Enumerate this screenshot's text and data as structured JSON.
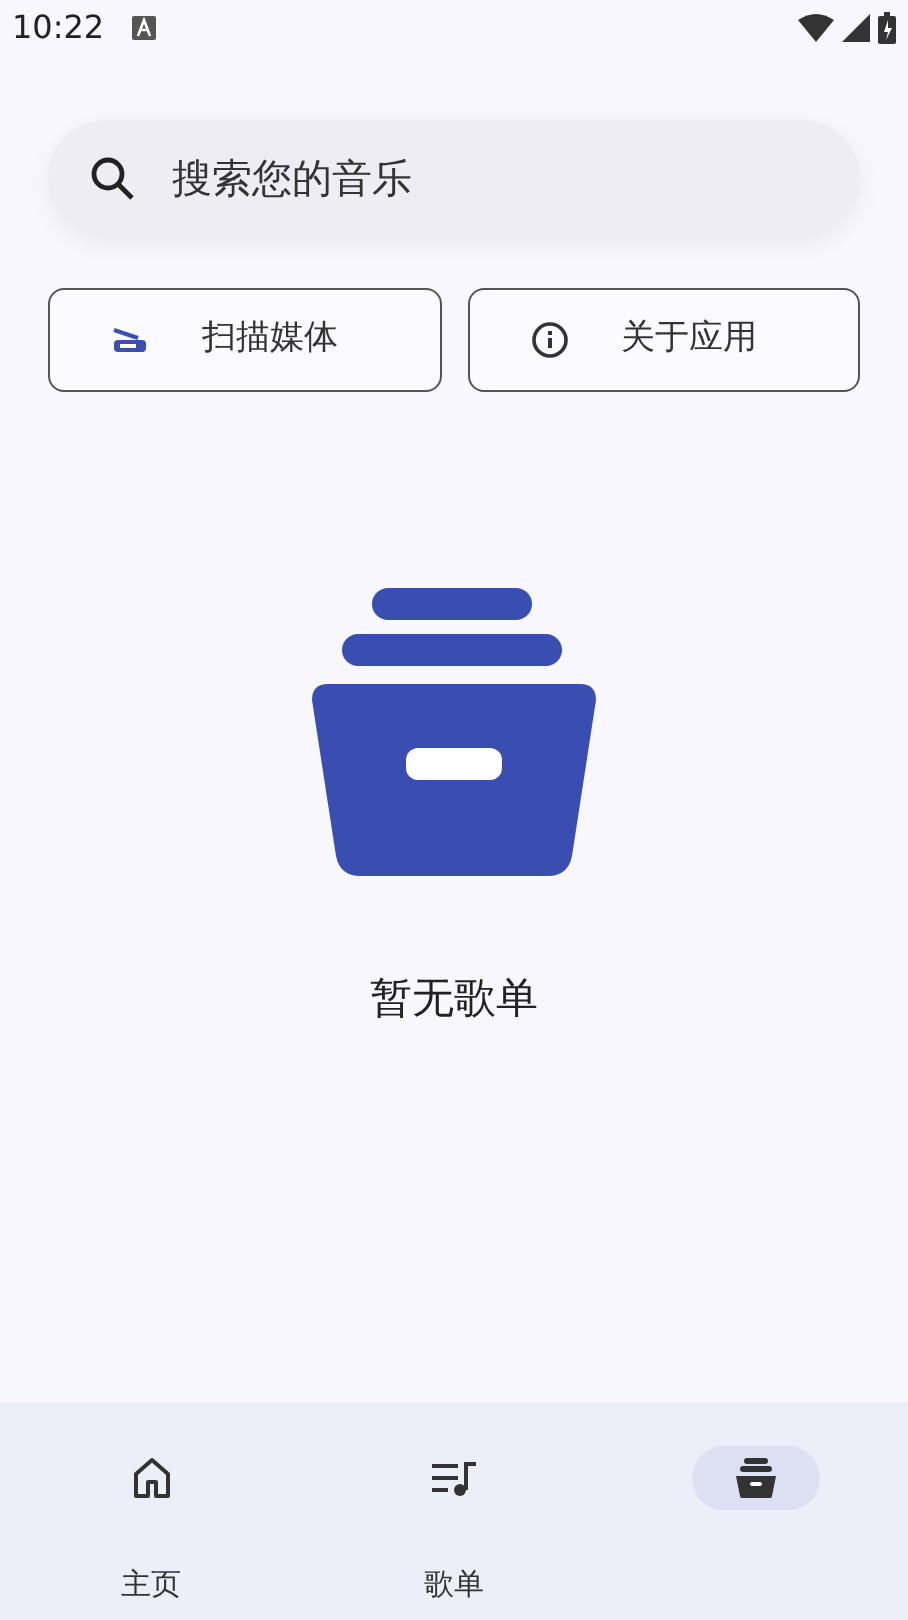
{
  "status_bar": {
    "time": "10:22"
  },
  "search": {
    "placeholder": "搜索您的音乐"
  },
  "actions": [
    {
      "kind": "scan",
      "label": "扫描媒体"
    },
    {
      "kind": "info",
      "label": "关于应用"
    }
  ],
  "empty_state": {
    "message": "暂无歌单"
  },
  "nav": [
    {
      "kind": "home",
      "label": "主页",
      "selected": false
    },
    {
      "kind": "playlist",
      "label": "歌单",
      "selected": false
    },
    {
      "kind": "library",
      "selected": true
    }
  ]
}
